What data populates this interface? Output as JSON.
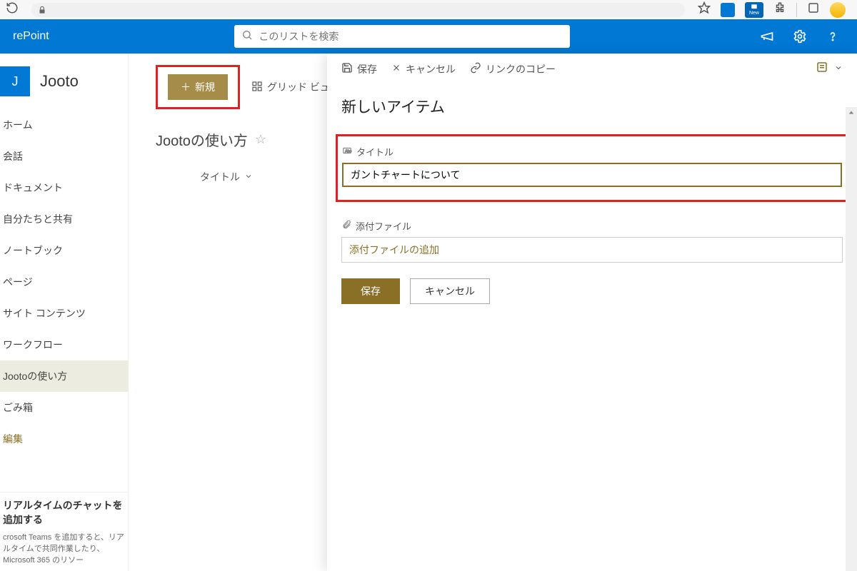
{
  "browser": {
    "new_badge": "New"
  },
  "suite": {
    "app_name": "rePoint",
    "search_placeholder": "このリストを検索"
  },
  "site": {
    "tile_letter": "J",
    "name": "Jooto"
  },
  "nav": {
    "items": [
      "ホーム",
      "会話",
      "ドキュメント",
      "自分たちと共有",
      "ノートブック",
      "ページ",
      "サイト コンテンツ",
      "ワークフロー",
      "Jootoの使い方",
      "ごみ箱"
    ],
    "edit": "編集"
  },
  "promo": {
    "title": "リアルタイムのチャットを追加する",
    "body": "crosoft Teams を追加すると、リアルタイムで共同作業したり、Microsoft 365 のリソー"
  },
  "toolbar": {
    "new_label": "新規",
    "grid_view_label": "グリッド ビュ"
  },
  "list": {
    "title": "Jootoの使い方",
    "column_title": "タイトル"
  },
  "panel": {
    "cmd_save": "保存",
    "cmd_cancel": "キャンセル",
    "cmd_copy_link": "リンクのコピー",
    "heading": "新しいアイテム",
    "field_title_label": "タイトル",
    "field_title_value": "ガントチャートについて",
    "attach_label": "添付ファイル",
    "attach_add": "添付ファイルの追加",
    "btn_save": "保存",
    "btn_cancel": "キャンセル"
  }
}
